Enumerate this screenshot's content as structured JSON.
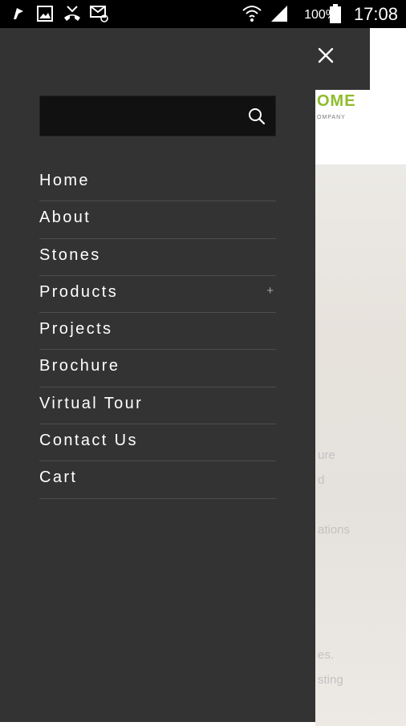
{
  "status_bar": {
    "battery_label": "100%",
    "time": "17:08",
    "icons": [
      "notification-flag-icon",
      "image-icon",
      "missed-call-icon",
      "email-icon",
      "wifi-icon",
      "signal-icon",
      "battery-icon"
    ]
  },
  "drawer": {
    "search": {
      "value": "",
      "placeholder": ""
    },
    "menu": [
      {
        "label": "Home",
        "has_children": false
      },
      {
        "label": "About",
        "has_children": false
      },
      {
        "label": "Stones",
        "has_children": false
      },
      {
        "label": "Products",
        "has_children": true,
        "expand_symbol": "+"
      },
      {
        "label": "Projects",
        "has_children": false
      },
      {
        "label": "Brochure",
        "has_children": false
      },
      {
        "label": "Virtual Tour",
        "has_children": false
      },
      {
        "label": "Contact Us",
        "has_children": false
      },
      {
        "label": "Cart",
        "has_children": false
      }
    ]
  },
  "background_page": {
    "logo_fragment": "OME",
    "logo_sub_fragment": "OMPANY",
    "text_fragments": [
      "ure",
      "d",
      "ations",
      "es.",
      "sting"
    ]
  },
  "colors": {
    "drawer_bg": "#333333",
    "search_bg": "#111111",
    "accent_green": "#8fbc2c",
    "status_bar_bg": "#000000"
  }
}
